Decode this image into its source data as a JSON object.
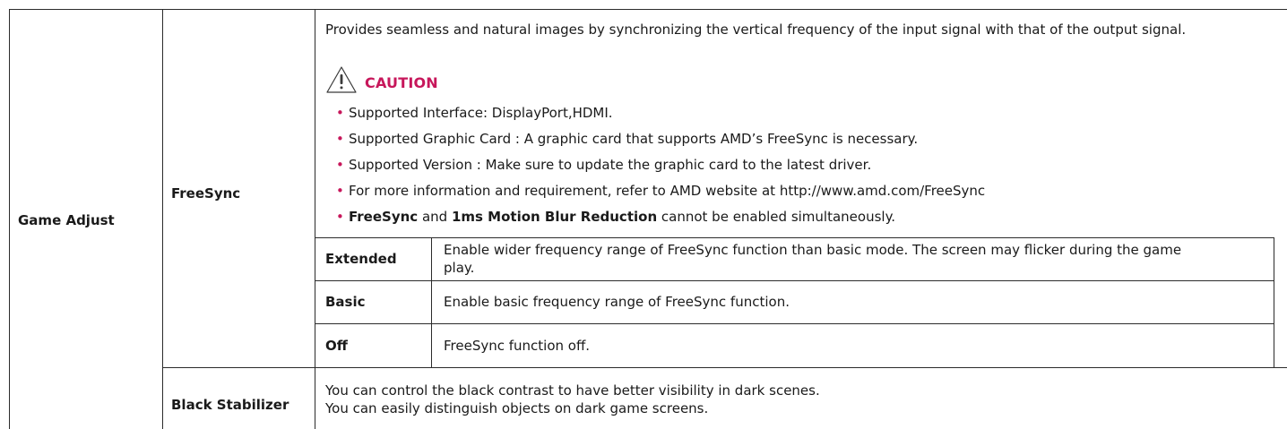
{
  "table": {
    "category": "Game Adjust",
    "freesync": {
      "label": "FreeSync",
      "description": "Provides seamless and natural images by synchronizing the vertical frequency of the input signal with that of the output signal.",
      "caution": {
        "icon": "caution-icon",
        "label": "CAUTION",
        "color": "#c7175b"
      },
      "notes": [
        "Supported Interface: DisplayPort,HDMI.",
        "Supported Graphic Card : A graphic card that supports AMD’s FreeSync is necessary.",
        "Supported Version : Make sure to update the graphic card to the latest driver.",
        "For more information and requirement, refer to AMD website at http://www.amd.com/FreeSync"
      ],
      "note_last": {
        "part1": "FreeSync",
        "part2": " and ",
        "part3": "1ms Motion Blur Reduction",
        "part4": " cannot be enabled simultaneously."
      },
      "options": [
        {
          "name": "Extended",
          "line1": "Enable wider frequency range of FreeSync function than basic mode. The screen may flicker during the game",
          "line2": "play."
        },
        {
          "name": "Basic",
          "line1": "Enable basic frequency range of FreeSync function."
        },
        {
          "name": "Off",
          "line1": "FreeSync function off."
        }
      ]
    },
    "black_stabilizer": {
      "label": "Black Stabilizer",
      "line1": "You can control the black contrast to have better visibility in dark scenes.",
      "line2": "You can easily distinguish objects on dark game screens."
    }
  }
}
